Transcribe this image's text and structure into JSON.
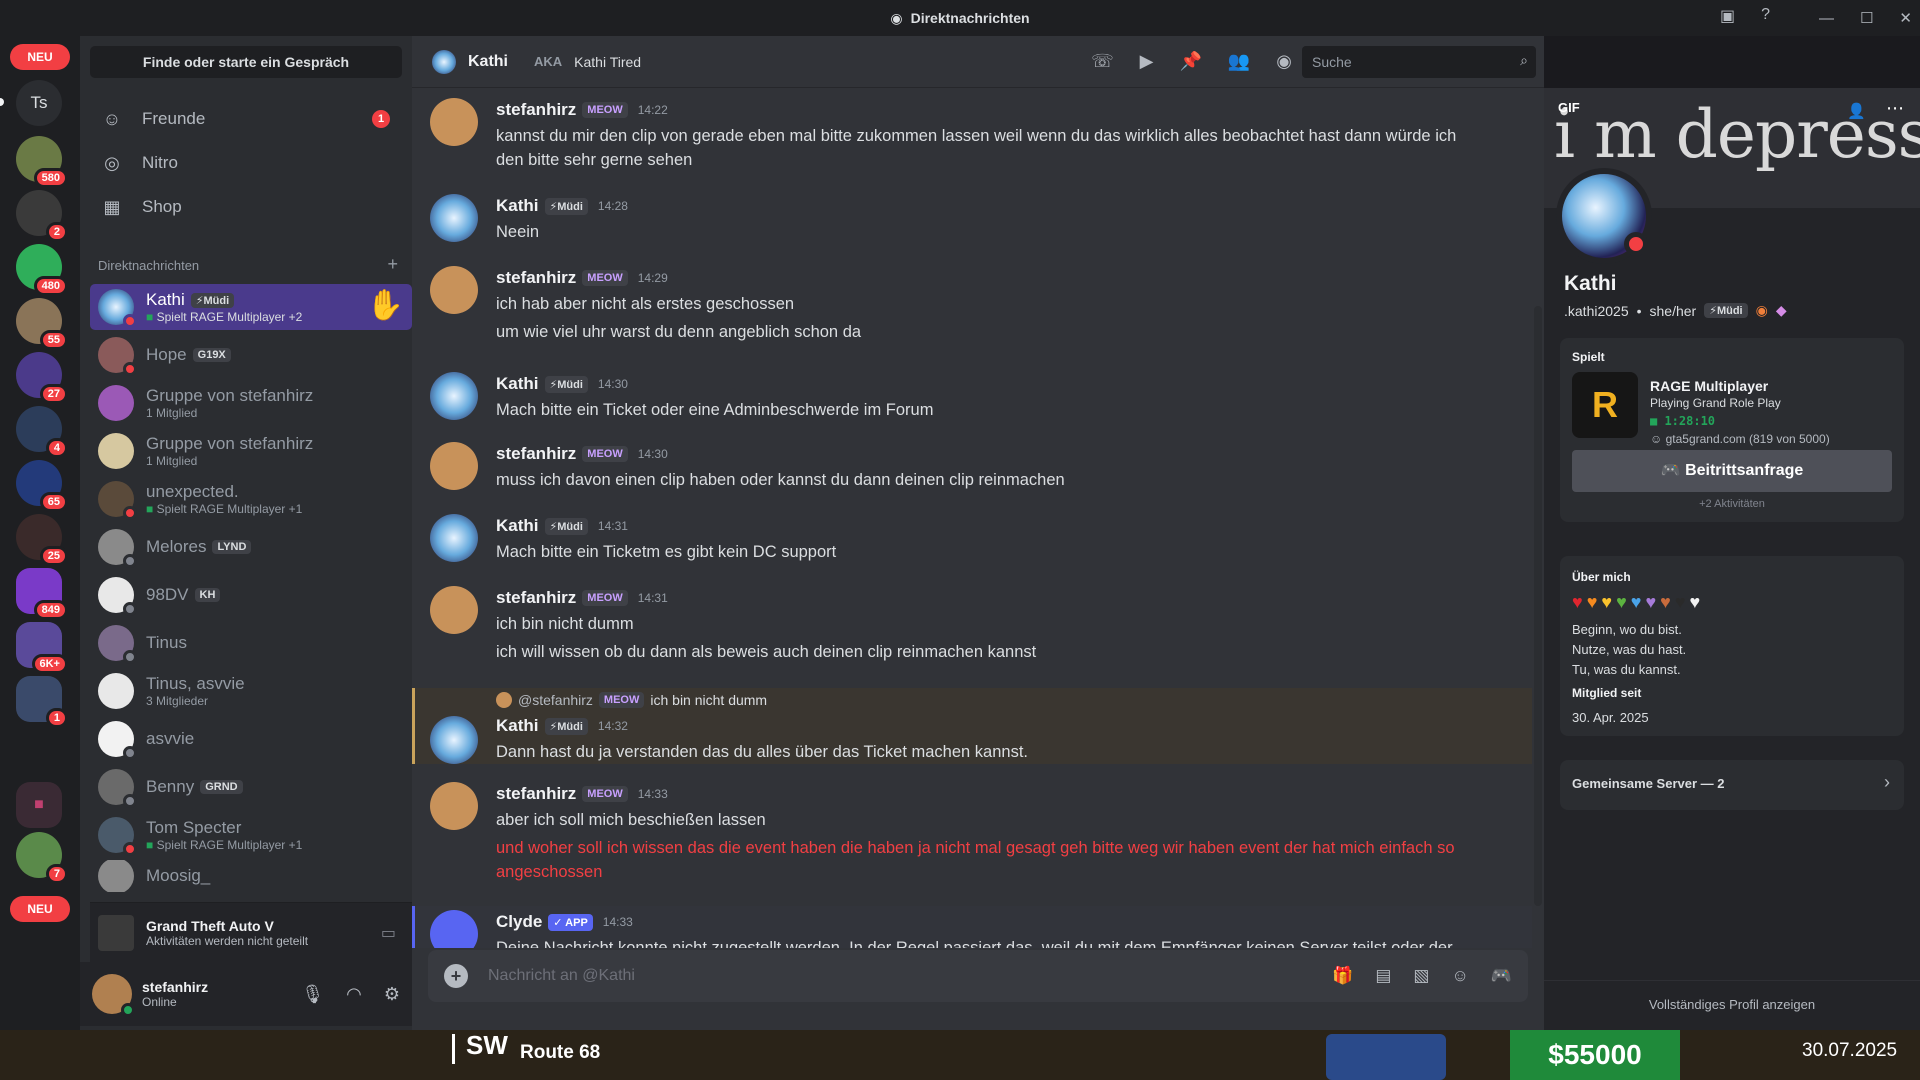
{
  "window": {
    "title": "Direktnachrichten"
  },
  "servers": {
    "neu_label": "NEU",
    "ts_label": "Ts",
    "badges": [
      "580",
      "2",
      "480",
      "55",
      "27",
      "4",
      "65",
      "25",
      "849",
      "6K+",
      "1",
      "7"
    ]
  },
  "dm_sidebar": {
    "search_label": "Finde oder starte ein Gespräch",
    "nav": [
      {
        "label": "Freunde",
        "badge": "1"
      },
      {
        "label": "Nitro"
      },
      {
        "label": "Shop"
      }
    ],
    "section_title": "Direktnachrichten",
    "section_add": "+",
    "items": [
      {
        "name": "Kathi",
        "tag": "⚡Müdi",
        "sub": "Spielt RAGE Multiplayer +2",
        "status": "dnd",
        "active": true
      },
      {
        "name": "Hope",
        "tag": "G19X",
        "sub": "",
        "status": "dnd"
      },
      {
        "name": "Gruppe von stefanhirz",
        "tag": "",
        "sub": "1 Mitglied",
        "status": ""
      },
      {
        "name": "Gruppe von stefanhirz",
        "tag": "",
        "sub": "1 Mitglied",
        "status": ""
      },
      {
        "name": "unexpected.",
        "tag": "",
        "sub": "Spielt RAGE Multiplayer +1",
        "status": "dnd"
      },
      {
        "name": "Melores",
        "tag": "LYND",
        "sub": "",
        "status": "idle"
      },
      {
        "name": "98DV",
        "tag": "KH",
        "sub": "",
        "status": "idle"
      },
      {
        "name": "Tinus",
        "tag": "",
        "sub": "",
        "status": "idle"
      },
      {
        "name": "Tinus, asvvie",
        "tag": "",
        "sub": "3 Mitglieder",
        "status": ""
      },
      {
        "name": "asvvie",
        "tag": "",
        "sub": "",
        "status": "idle"
      },
      {
        "name": "Benny",
        "tag": "GRND",
        "sub": "",
        "status": "idle"
      },
      {
        "name": "Tom Specter",
        "tag": "",
        "sub": "Spielt RAGE Multiplayer +1",
        "status": "dnd"
      },
      {
        "name": "Moosig_",
        "tag": "",
        "sub": "",
        "status": ""
      }
    ],
    "activity": {
      "game": "Grand Theft Auto V",
      "note": "Aktivitäten werden nicht geteilt"
    },
    "user": {
      "name": "stefanhirz",
      "status": "Online"
    }
  },
  "chat_header": {
    "name": "Kathi",
    "aka_label": "AKA",
    "aka_name": "Kathi Tired",
    "search_placeholder": "Suche"
  },
  "messages": [
    {
      "author": "stefanhirz",
      "badge": "MEOW",
      "time": "14:22",
      "lines": [
        "kannst du mir den clip von gerade eben mal bitte zukommen lassen weil wenn du das wirklich alles beobachtet hast dann würde ich",
        "den bitte sehr gerne sehen"
      ]
    },
    {
      "author": "Kathi",
      "badge": "⚡Müdi",
      "time": "14:28",
      "lines": [
        "Neein"
      ]
    },
    {
      "author": "stefanhirz",
      "badge": "MEOW",
      "time": "14:29",
      "lines": [
        "ich hab aber nicht als erstes geschossen",
        "um wie viel uhr warst du denn angeblich schon da"
      ]
    },
    {
      "author": "Kathi",
      "badge": "⚡Müdi",
      "time": "14:30",
      "lines": [
        "Mach bitte ein Ticket oder eine Adminbeschwerde im Forum"
      ]
    },
    {
      "author": "stefanhirz",
      "badge": "MEOW",
      "time": "14:30",
      "lines": [
        "muss ich davon einen clip haben oder kannst du dann deinen clip reinmachen"
      ]
    },
    {
      "author": "Kathi",
      "badge": "⚡Müdi",
      "time": "14:31",
      "lines": [
        "Mach bitte ein Ticketm es gibt kein DC support"
      ]
    },
    {
      "author": "stefanhirz",
      "badge": "MEOW",
      "time": "14:31",
      "lines": [
        "ich bin nicht dumm",
        "ich will wissen ob du dann als beweis auch deinen clip reinmachen kannst"
      ]
    },
    {
      "author": "Kathi",
      "badge": "⚡Müdi",
      "time": "14:32",
      "reply_to": "@stefanhirz",
      "reply_badge": "MEOW",
      "reply_text": "ich bin nicht dumm",
      "lines": [
        "Dann hast du ja verstanden das du alles über das Ticket machen kannst."
      ]
    },
    {
      "author": "stefanhirz",
      "badge": "MEOW",
      "time": "14:33",
      "lines": [
        "aber ich soll mich beschießen lassen"
      ],
      "red_lines": [
        "und woher soll ich wissen das die event haben die haben ja nicht mal gesagt geh bitte weg wir haben event der hat mich einfach so",
        "angeschossen"
      ]
    },
    {
      "author": "Clyde",
      "badge": "✓ APP",
      "time": "14:33",
      "lines": [
        "Deine Nachricht konnte nicht zugestellt werden. In der Regel passiert das, weil du mit dem Empfänger keinen Server teilst oder der"
      ]
    }
  ],
  "composer": {
    "placeholder": "Nachricht an @Kathi"
  },
  "profile": {
    "banner_label": "GIF",
    "banner_text": "i m depressed",
    "name": "Kathi",
    "handle": ".kathi2025",
    "pronouns": "she/her",
    "tag": "⚡Müdi",
    "playing_header": "Spielt",
    "game_title": "RAGE Multiplayer",
    "game_detail": "Playing Grand Role Play",
    "game_time": "1:28:10",
    "game_server": "gta5grand.com (819 von 5000)",
    "join_button": "Beitrittsanfrage",
    "more_activities": "+2 Aktivitäten",
    "about_header": "Über mich",
    "about_lines": [
      "Beginn, wo du bist.",
      "Nutze, was du hast.",
      "Tu, was du kannst."
    ],
    "member_since_header": "Mitglied seit",
    "member_since": "30. Apr. 2025",
    "mutual_servers": "Gemeinsame Server — 2",
    "full_profile": "Vollständiges Profil anzeigen"
  },
  "game_overlay": {
    "location": "Route 68",
    "money": "$55000",
    "date": "30.07.2025",
    "compass": "SW"
  }
}
